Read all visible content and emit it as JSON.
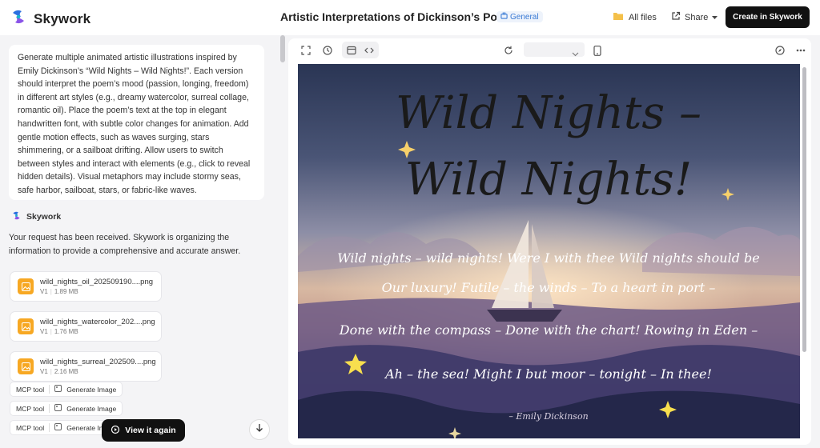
{
  "header": {
    "logo_text": "Skywork",
    "title": "Artistic Interpretations of Dickinson’s Poem",
    "badge": "General",
    "all_files": "All files",
    "share": "Share",
    "create_button": "Create in Skywork"
  },
  "prompt": {
    "text": "Generate multiple animated artistic illustrations inspired by Emily Dickinson’s “Wild Nights – Wild Nights!”. Each version should interpret the poem’s mood (passion, longing, freedom) in different art styles (e.g., dreamy watercolor, surreal collage, romantic oil). Place the poem’s text at the top in elegant handwritten font, with subtle color changes for animation. Add gentle motion effects, such as waves surging, stars shimmering, or a sailboat drifting. Allow users to switch between styles and interact with elements (e.g., click to reveal hidden details). Visual metaphors may include stormy seas, safe harbor, sailboat, stars, or fabric-like waves."
  },
  "assistant": {
    "name": "Skywork",
    "reply": "Your request has been received. Skywork is organizing the information to provide a comprehensive and accurate answer."
  },
  "files": [
    {
      "name": "wild_nights_oil_202509190....png",
      "version": "V1",
      "size": "1.89 MB"
    },
    {
      "name": "wild_nights_watercolor_202....png",
      "version": "V1",
      "size": "1.76 MB"
    },
    {
      "name": "wild_nights_surreal_202509....png",
      "version": "V1",
      "size": "2.16 MB"
    }
  ],
  "tools": [
    {
      "tag": "MCP tool",
      "action": "Generate Image"
    },
    {
      "tag": "MCP tool",
      "action": "Generate Image"
    },
    {
      "tag": "MCP tool",
      "action": "Generate Image"
    }
  ],
  "view_again": "View it again",
  "artwork": {
    "title_line1": "Wild Nights –",
    "title_line2": "Wild Nights!",
    "lines": [
      "Wild nights – wild nights! Were I with thee Wild nights should be",
      "Our luxury! Futile – the winds – To a heart in port –",
      "Done with the compass – Done with the chart! Rowing in Eden –",
      "Ah – the sea! Might I but moor – tonight – In thee!"
    ],
    "signature": "– Emily Dickinson"
  },
  "colors": {
    "accent": "#111111",
    "file_icon": "#f7a823",
    "badge": "#3a7bd5"
  }
}
